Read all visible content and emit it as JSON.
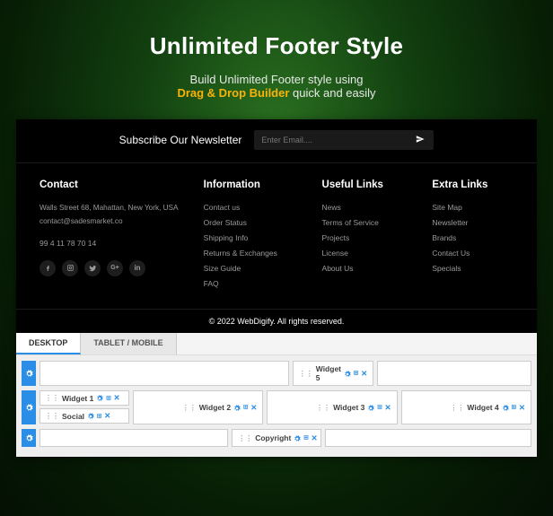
{
  "hero": {
    "title": "Unlimited Footer Style",
    "line1": "Build Unlimited Footer style using",
    "highlight": "Drag & Drop Builder",
    "line2_tail": " quick and easily"
  },
  "newsletter": {
    "title": "Subscribe Our Newsletter",
    "placeholder": "Enter Email...."
  },
  "footer": {
    "contact": {
      "heading": "Contact",
      "address": "Walls Street 68, Mahattan, New York, USA",
      "email": "contact@sadesmarket.co",
      "phone": "99 4 11 78 70 14"
    },
    "info": {
      "heading": "Information",
      "items": [
        "Contact us",
        "Order Status",
        "Shipping Info",
        "Returns & Exchanges",
        "Size Guide",
        "FAQ"
      ]
    },
    "useful": {
      "heading": "Useful Links",
      "items": [
        "News",
        "Terms of Service",
        "Projects",
        "License",
        "About Us"
      ]
    },
    "extra": {
      "heading": "Extra Links",
      "items": [
        "Site Map",
        "Newsletter",
        "Brands",
        "Contact Us",
        "Specials"
      ]
    },
    "copyright": "© 2022 WebDigify. All rights reserved."
  },
  "builder": {
    "tabs": {
      "desktop": "DESKTOP",
      "mobile": "TABLET / MOBILE"
    },
    "widgets": {
      "w1": "Widget 1",
      "w2": "Widget 2",
      "w3": "Widget 3",
      "w4": "Widget 4",
      "w5": "Widget 5",
      "social": "Social",
      "copyright": "Copyright"
    },
    "icons": {
      "plus": "⊞",
      "close": "✕",
      "drag": "⋮⋮"
    }
  }
}
